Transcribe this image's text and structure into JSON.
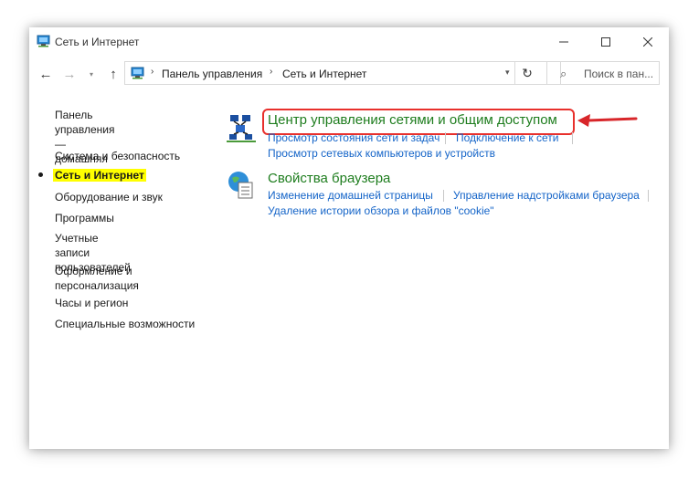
{
  "window": {
    "title": "Сеть и Интернет",
    "controls": {
      "minimize": "—",
      "maximize": "☐",
      "close": "✕"
    }
  },
  "nav": {
    "back": "←",
    "forward": "→",
    "recent": "▾",
    "up": "↑",
    "breadcrumb": [
      "Панель управления",
      "Сеть и Интернет"
    ],
    "breadcrumb_separator": "›",
    "refresh": "↻",
    "search_placeholder": "Поиск в пан..."
  },
  "sidebar": {
    "items": [
      {
        "label": "Панель управления —\nдомашняя страница",
        "current": false
      },
      {
        "label": "Система и безопасность",
        "current": false
      },
      {
        "label": "Сеть и Интернет",
        "current": true
      },
      {
        "label": "Оборудование и звук",
        "current": false
      },
      {
        "label": "Программы",
        "current": false
      },
      {
        "label": "Учетные записи\nпользователей",
        "current": false
      },
      {
        "label": "Оформление и\nперсонализация",
        "current": false
      },
      {
        "label": "Часы и регион",
        "current": false
      },
      {
        "label": "Специальные возможности",
        "current": false
      }
    ]
  },
  "categories": [
    {
      "title": "Центр управления сетями и общим доступом",
      "icon": "network-center-icon",
      "links": [
        "Просмотр состояния сети и задач",
        "Подключение к сети",
        "Просмотр сетевых компьютеров и устройств"
      ]
    },
    {
      "title": "Свойства браузера",
      "icon": "browser-properties-icon",
      "links": [
        "Изменение домашней страницы",
        "Управление надстройками браузера",
        "Удаление истории обзора и файлов \"cookie\""
      ]
    }
  ],
  "colors": {
    "category_title": "#1e7d1e",
    "link": "#1464c8",
    "highlight": "#ffff00",
    "annotation": "#e8302c"
  }
}
